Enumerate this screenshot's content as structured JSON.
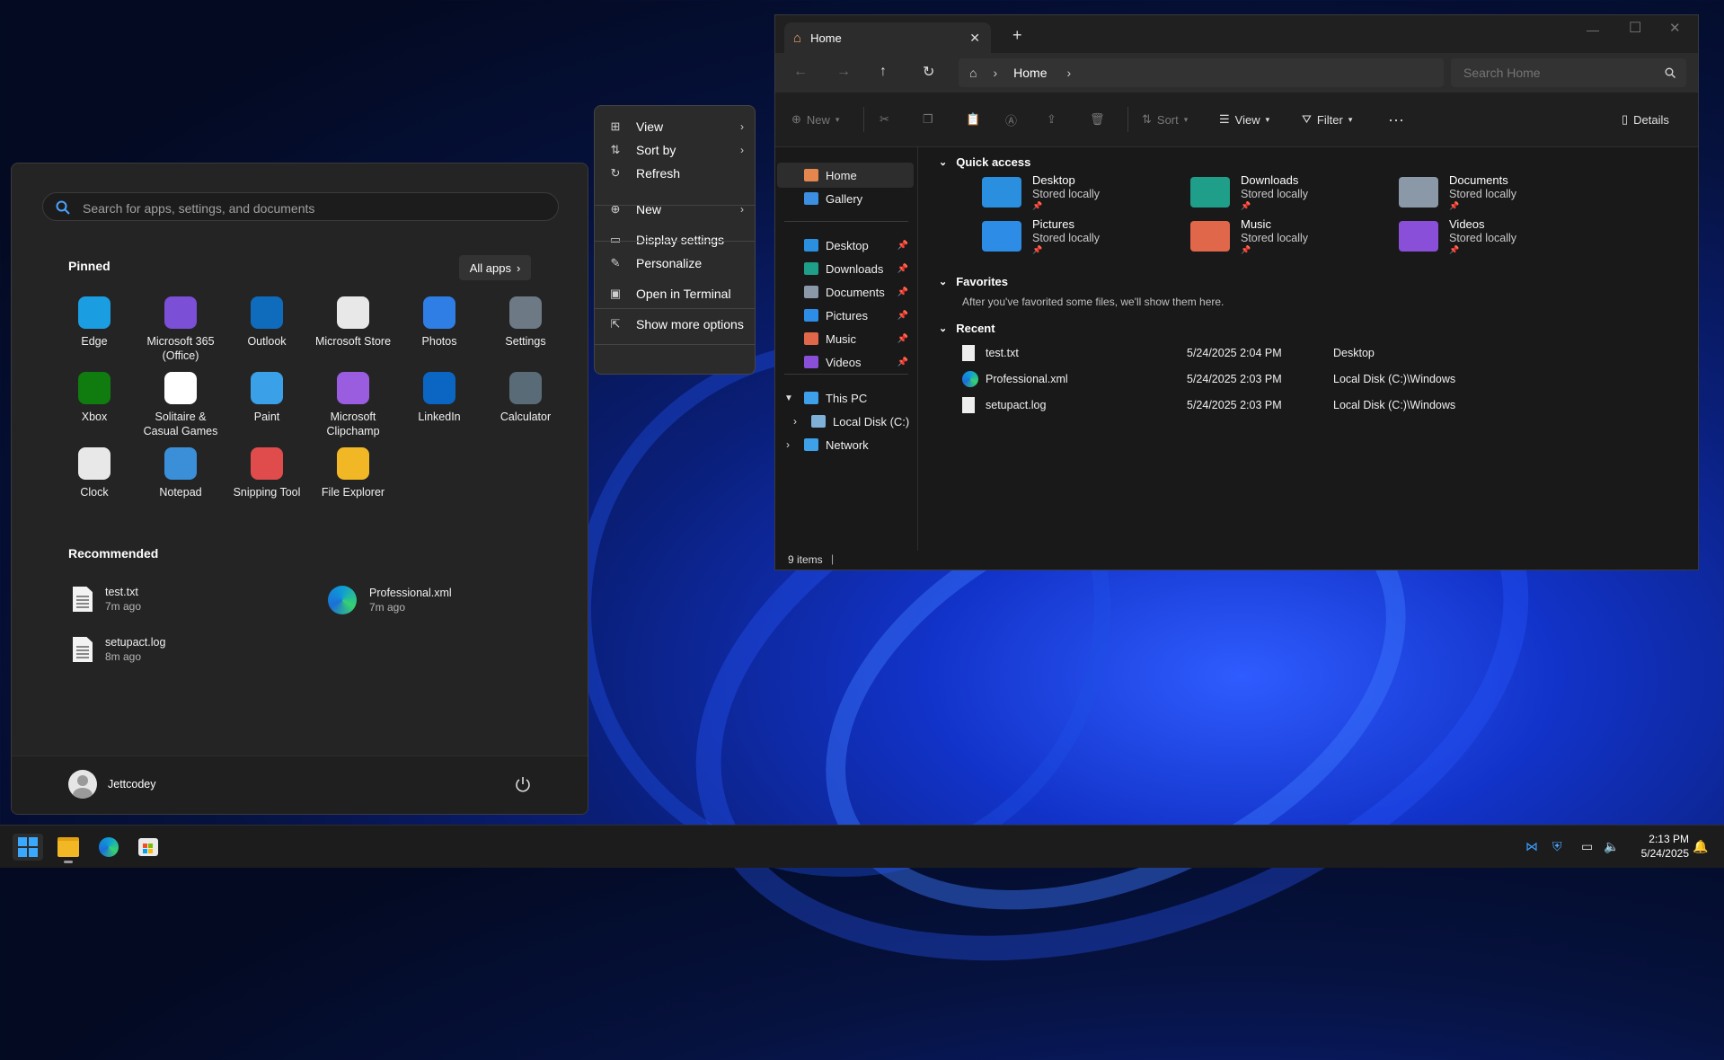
{
  "start_menu": {
    "search_placeholder": "Search for apps, settings, and documents",
    "pinned_title": "Pinned",
    "all_apps_label": "All apps",
    "pinned": [
      {
        "label": "Edge",
        "icon": "edge-icon",
        "color": "#1b9de2"
      },
      {
        "label": "Microsoft 365\n(Office)",
        "icon": "microsoft-365-icon",
        "color": "#7b4fd6"
      },
      {
        "label": "Outlook",
        "icon": "outlook-icon",
        "color": "#0f6cbd"
      },
      {
        "label": "Microsoft Store",
        "icon": "microsoft-store-icon",
        "color": "#e8e8e8"
      },
      {
        "label": "Photos",
        "icon": "photos-icon",
        "color": "#2f7ee6"
      },
      {
        "label": "Settings",
        "icon": "settings-icon",
        "color": "#6d7a85"
      },
      {
        "label": "Xbox",
        "icon": "xbox-icon",
        "color": "#107c10"
      },
      {
        "label": "Solitaire &\nCasual Games",
        "icon": "solitaire-icon",
        "color": "#ffffff"
      },
      {
        "label": "Paint",
        "icon": "paint-icon",
        "color": "#3aa0e8"
      },
      {
        "label": "Microsoft\nClipchamp",
        "icon": "clipchamp-icon",
        "color": "#9a5de0"
      },
      {
        "label": "LinkedIn",
        "icon": "linkedin-icon",
        "color": "#0a66c2"
      },
      {
        "label": "Calculator",
        "icon": "calculator-icon",
        "color": "#5a6b78"
      },
      {
        "label": "Clock",
        "icon": "clock-icon",
        "color": "#e8e8e8"
      },
      {
        "label": "Notepad",
        "icon": "notepad-icon",
        "color": "#3b8fd8"
      },
      {
        "label": "Snipping Tool",
        "icon": "snipping-tool-icon",
        "color": "#e04b4b"
      },
      {
        "label": "File Explorer",
        "icon": "file-explorer-icon",
        "color": "#f2b724"
      }
    ],
    "recommended_title": "Recommended",
    "recommended": [
      {
        "name": "test.txt",
        "time": "7m ago",
        "icon": "text-file-icon"
      },
      {
        "name": "Professional.xml",
        "time": "7m ago",
        "icon": "edge-icon"
      },
      {
        "name": "setupact.log",
        "time": "8m ago",
        "icon": "text-file-icon"
      }
    ],
    "user_name": "Jettcodey"
  },
  "context_menu": {
    "items": [
      {
        "label": "View",
        "icon": "grid-icon",
        "submenu": true
      },
      {
        "label": "Sort by",
        "icon": "sort-icon",
        "submenu": true
      },
      {
        "label": "Refresh",
        "icon": "refresh-icon",
        "submenu": false
      },
      {
        "label": "New",
        "icon": "plus-icon",
        "submenu": true
      },
      {
        "label": "Display settings",
        "icon": "display-icon",
        "submenu": false
      },
      {
        "label": "Personalize",
        "icon": "pen-icon",
        "submenu": false
      },
      {
        "label": "Open in Terminal",
        "icon": "terminal-icon",
        "submenu": false
      },
      {
        "label": "Show more options",
        "icon": "share-icon",
        "submenu": false
      }
    ]
  },
  "explorer": {
    "tab_title": "Home",
    "breadcrumb": "Home",
    "search_placeholder": "Search Home",
    "commands": {
      "new": "New",
      "sort": "Sort",
      "view": "View",
      "filter": "Filter",
      "details": "Details"
    },
    "nav": {
      "home": "Home",
      "gallery": "Gallery",
      "pinned": [
        {
          "label": "Desktop",
          "color": "#2b8fe0"
        },
        {
          "label": "Downloads",
          "color": "#1f9e8a"
        },
        {
          "label": "Documents",
          "color": "#8a98a8"
        },
        {
          "label": "Pictures",
          "color": "#2d8de6"
        },
        {
          "label": "Music",
          "color": "#e0674a"
        },
        {
          "label": "Videos",
          "color": "#8a4fd8"
        }
      ],
      "this_pc": "This PC",
      "local_disk": "Local Disk (C:)",
      "network": "Network"
    },
    "quick_access_title": "Quick access",
    "quick_access": [
      {
        "name": "Desktop",
        "status": "Stored locally",
        "color": "#2b8fe0"
      },
      {
        "name": "Downloads",
        "status": "Stored locally",
        "color": "#1f9e8a"
      },
      {
        "name": "Documents",
        "status": "Stored locally",
        "color": "#8a98a8"
      },
      {
        "name": "Pictures",
        "status": "Stored locally",
        "color": "#2d8de6"
      },
      {
        "name": "Music",
        "status": "Stored locally",
        "color": "#e0674a"
      },
      {
        "name": "Videos",
        "status": "Stored locally",
        "color": "#8a4fd8"
      }
    ],
    "favorites_title": "Favorites",
    "favorites_empty": "After you've favorited some files, we'll show them here.",
    "recent_title": "Recent",
    "recent": [
      {
        "name": "test.txt",
        "date": "5/24/2025 2:04 PM",
        "location": "Desktop",
        "icon": "text-file-icon"
      },
      {
        "name": "Professional.xml",
        "date": "5/24/2025 2:03 PM",
        "location": "Local Disk (C:)\\Windows",
        "icon": "edge-icon"
      },
      {
        "name": "setupact.log",
        "date": "5/24/2025 2:03 PM",
        "location": "Local Disk (C:)\\Windows",
        "icon": "text-file-icon"
      }
    ],
    "status_items": "9 items"
  },
  "taskbar": {
    "time": "2:13 PM",
    "date": "5/24/2025"
  }
}
